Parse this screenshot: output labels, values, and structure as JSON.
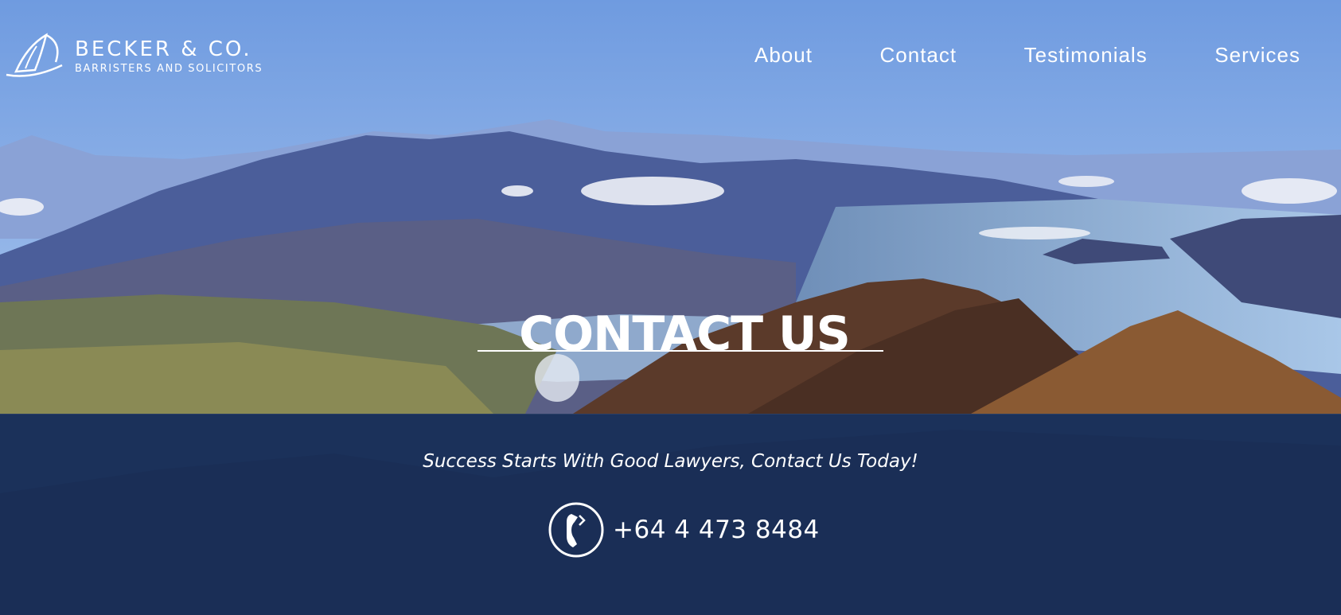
{
  "brand": {
    "name": "BECKER & CO.",
    "tagline": "BARRISTERS AND SOLICITORS",
    "logo_icon": "sailboat-icon"
  },
  "nav": {
    "items": [
      "About",
      "Contact",
      "Testimonials",
      "Services"
    ]
  },
  "hero": {
    "title": "CONTACT US",
    "background": "mountain-lake-landscape"
  },
  "contact_band": {
    "message": "Success Starts With Good Lawyers, Contact Us Today!",
    "phone_icon": "phone-icon",
    "phone": "+64 4 473 8484"
  },
  "colors": {
    "sky_top": "#7da7e6",
    "band": "#1c3763",
    "text": "#ffffff"
  }
}
